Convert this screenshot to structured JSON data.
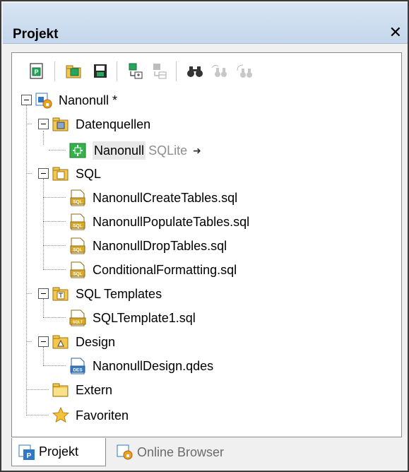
{
  "window": {
    "title": "Projekt",
    "close_glyph": "✕"
  },
  "toolbar": {
    "buttons": [
      {
        "icon": "new-project-icon",
        "enabled": true
      },
      {
        "icon": "open-project-icon",
        "enabled": true
      },
      {
        "icon": "save-project-icon",
        "enabled": true
      },
      {
        "icon": "add-datasource-icon",
        "enabled": true
      },
      {
        "icon": "add-folder-icon",
        "enabled": false
      },
      {
        "icon": "find-icon",
        "enabled": true
      },
      {
        "icon": "find-next-icon",
        "enabled": false
      },
      {
        "icon": "find-replace-icon",
        "enabled": false
      }
    ]
  },
  "tree": {
    "root": {
      "label": "Nanonull *"
    },
    "datasources": {
      "label": "Datenquellen",
      "item": {
        "label": "Nanonull",
        "type": "SQLite",
        "arrow": "➜"
      }
    },
    "sql": {
      "label": "SQL",
      "items": [
        "NanonullCreateTables.sql",
        "NanonullPopulateTables.sql",
        "NanonullDropTables.sql",
        "ConditionalFormatting.sql"
      ]
    },
    "sql_templates": {
      "label": "SQL Templates",
      "items": [
        "SQLTemplate1.sql"
      ]
    },
    "design": {
      "label": "Design",
      "items": [
        "NanonullDesign.qdes"
      ]
    },
    "extern": {
      "label": "Extern"
    },
    "favorites": {
      "label": "Favoriten"
    }
  },
  "tabs": [
    {
      "label": "Projekt",
      "active": true
    },
    {
      "label": "Online Browser",
      "active": false
    }
  ],
  "colors": {
    "titlebar": "#cddcee",
    "folder": "#f7c948",
    "db_green": "#2ea043",
    "sql_file": "#e0b23a",
    "accent_blue": "#2f78c4"
  }
}
